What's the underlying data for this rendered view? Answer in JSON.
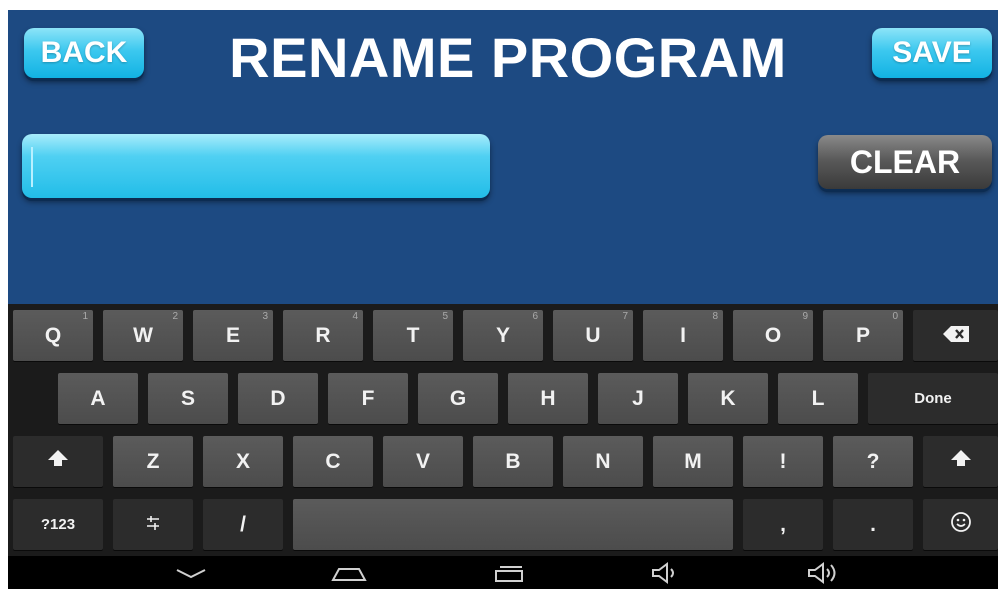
{
  "header": {
    "back_label": "BACK",
    "title": "RENAME PROGRAM",
    "save_label": "SAVE"
  },
  "name_field": {
    "value": "",
    "placeholder": ""
  },
  "clear_label": "CLEAR",
  "keyboard": {
    "row1": [
      {
        "label": "Q",
        "hint": "1"
      },
      {
        "label": "W",
        "hint": "2"
      },
      {
        "label": "E",
        "hint": "3"
      },
      {
        "label": "R",
        "hint": "4"
      },
      {
        "label": "T",
        "hint": "5"
      },
      {
        "label": "Y",
        "hint": "6"
      },
      {
        "label": "U",
        "hint": "7"
      },
      {
        "label": "I",
        "hint": "8"
      },
      {
        "label": "O",
        "hint": "9"
      },
      {
        "label": "P",
        "hint": "0"
      }
    ],
    "row2": [
      "A",
      "S",
      "D",
      "F",
      "G",
      "H",
      "J",
      "K",
      "L"
    ],
    "done_label": "Done",
    "row3": [
      "Z",
      "X",
      "C",
      "V",
      "B",
      "N",
      "M",
      "!",
      "?"
    ],
    "symbols_label": "?123",
    "slash_label": "/",
    "comma_label": ",",
    "period_label": ".",
    "icons": {
      "backspace": "backspace-icon",
      "shift": "shift-icon",
      "settings": "settings-icon",
      "emoji": "emoji-icon"
    }
  },
  "navbar": {
    "icons": [
      "hide-keyboard-icon",
      "home-icon",
      "recent-apps-icon",
      "volume-down-icon",
      "volume-up-icon"
    ]
  },
  "colors": {
    "background": "#1d4a82",
    "accent": "#22bde8",
    "keyboard": "#1b1b1b"
  }
}
